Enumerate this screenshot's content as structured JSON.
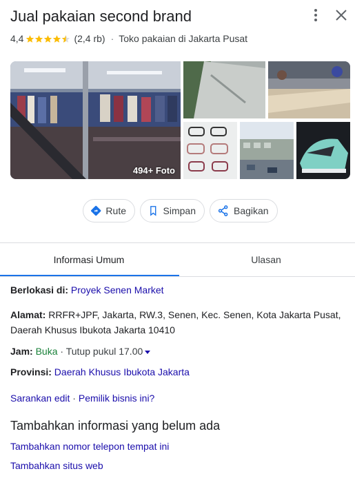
{
  "header": {
    "title": "Jual pakaian second brand",
    "more_icon": "more-vert-icon",
    "close_icon": "close-icon"
  },
  "rating": {
    "value": "4,4",
    "stars_filled": 4.4,
    "star_color": "#fbbc04",
    "review_count": "(2,4 rb)",
    "separator": "·",
    "category": "Toko pakaian di Jakarta Pusat"
  },
  "photos": {
    "count_label": "494+ Foto"
  },
  "actions": {
    "directions": "Rute",
    "save": "Simpan",
    "share": "Bagikan",
    "accent": "#1a73e8"
  },
  "tabs": {
    "overview": "Informasi Umum",
    "reviews": "Ulasan"
  },
  "info": {
    "located_in_label": "Berlokasi di:",
    "located_in_value": "Proyek Senen Market",
    "address_label": "Alamat:",
    "address_line1": "RRFR+JPF, Jakarta, RW.3, Senen, Kec. Senen, Kota Jakarta Pusat,",
    "address_line2": "Daerah Khusus Ibukota Jakarta 10410",
    "hours_label": "Jam:",
    "hours_status": "Buka",
    "hours_separator": "·",
    "hours_detail": "Tutup pukul 17.00",
    "province_label": "Provinsi:",
    "province_value": "Daerah Khusus Ibukota Jakarta",
    "suggest_edit": "Sarankan edit",
    "links_separator": "·",
    "own_business": "Pemilik bisnis ini?"
  },
  "add_info": {
    "title": "Tambahkan informasi yang belum ada",
    "add_phone": "Tambahkan nomor telepon tempat ini",
    "add_website": "Tambahkan situs web"
  }
}
